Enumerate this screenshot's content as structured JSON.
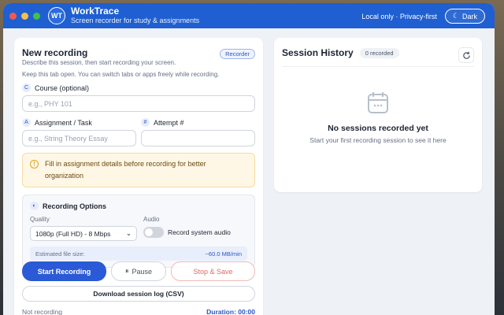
{
  "app": {
    "logo_text": "WT",
    "name": "WorkTrace",
    "tagline": "Screen recorder for study & assignments",
    "status": "Local only · Privacy-first",
    "theme_button": "Dark"
  },
  "colors": {
    "accent": "#1f5fd1",
    "dot_red": "#ef5a52",
    "dot_yellow": "#f4bf4f",
    "dot_green": "#3fc14b",
    "stop_red": "#e06a62"
  },
  "recording": {
    "title": "New recording",
    "badge": "Recorder",
    "description": "Describe this session, then start recording your screen.",
    "note": "Keep this tab open. You can switch tabs or apps freely while recording.",
    "course_label": "Course (optional)",
    "course_icon_letter": "C",
    "course_placeholder": "e.g., PHY 101",
    "assignment_label": "Assignment / Task",
    "assignment_icon_letter": "A",
    "assignment_placeholder": "e.g., String Theory Essay",
    "attempt_label": "Attempt #",
    "attempt_icon_letter": "#",
    "attempt_placeholder": "",
    "warning": "Fill in assignment details before recording for better organization"
  },
  "options": {
    "title": "Recording Options",
    "quality_label": "Quality",
    "quality_value": "1080p (Full HD) - 8 Mbps",
    "audio_label": "Audio",
    "audio_toggle_label": "Record system audio",
    "audio_enabled": false,
    "estimate_label": "Estimated file size:",
    "estimate_value": "~60.0 MB/min"
  },
  "actions": {
    "start": "Start Recording",
    "pause": "Pause",
    "stop": "Stop & Save",
    "download": "Download session log (CSV)"
  },
  "status": {
    "state": "Not recording",
    "duration": "Duration: 00:00"
  },
  "history": {
    "title": "Session History",
    "count_badge": "0 recorded",
    "empty_title": "No sessions recorded yet",
    "empty_sub": "Start your first recording session to see it here"
  }
}
